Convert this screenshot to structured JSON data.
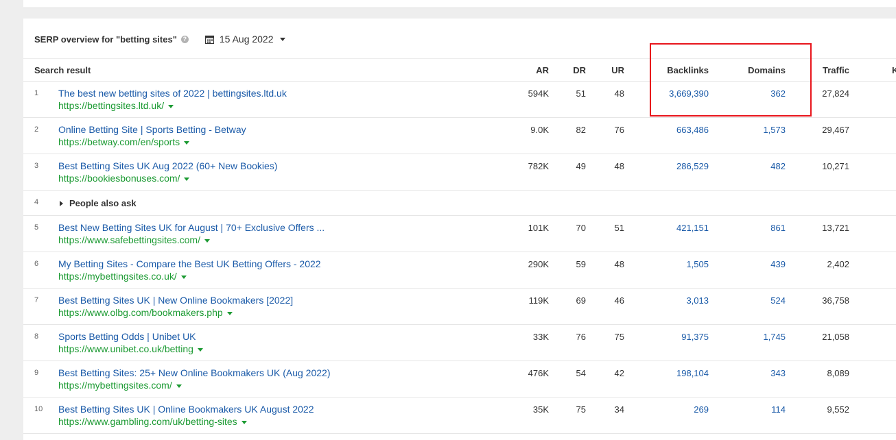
{
  "header": {
    "title": "SERP overview for \"betting sites\"",
    "help_icon": "?",
    "date": "15 Aug 2022"
  },
  "columns": {
    "search_result": "Search result",
    "ar": "AR",
    "dr": "DR",
    "ur": "UR",
    "backlinks": "Backlinks",
    "domains": "Domains",
    "traffic": "Traffic",
    "k": "K"
  },
  "rows": [
    {
      "rank": "1",
      "title": "The best new betting sites of 2022 | bettingsites.ltd.uk",
      "url": "https://bettingsites.ltd.uk/",
      "ar": "594K",
      "dr": "51",
      "ur": "48",
      "backlinks": "3,669,390",
      "domains": "362",
      "traffic": "27,824"
    },
    {
      "rank": "2",
      "title": "Online Betting Site | Sports Betting - Betway",
      "url": "https://betway.com/en/sports",
      "ar": "9.0K",
      "dr": "82",
      "ur": "76",
      "backlinks": "663,486",
      "domains": "1,573",
      "traffic": "29,467"
    },
    {
      "rank": "3",
      "title": "Best Betting Sites UK Aug 2022 (60+ New Bookies)",
      "url": "https://bookiesbonuses.com/",
      "ar": "782K",
      "dr": "49",
      "ur": "48",
      "backlinks": "286,529",
      "domains": "482",
      "traffic": "10,271"
    },
    {
      "rank": "5",
      "title": "Best New Betting Sites UK for August | 70+ Exclusive Offers ...",
      "url": "https://www.safebettingsites.com/",
      "ar": "101K",
      "dr": "70",
      "ur": "51",
      "backlinks": "421,151",
      "domains": "861",
      "traffic": "13,721"
    },
    {
      "rank": "6",
      "title": "My Betting Sites - Compare the Best UK Betting Offers - 2022",
      "url": "https://mybettingsites.co.uk/",
      "ar": "290K",
      "dr": "59",
      "ur": "48",
      "backlinks": "1,505",
      "domains": "439",
      "traffic": "2,402"
    },
    {
      "rank": "7",
      "title": "Best Betting Sites UK | New Online Bookmakers [2022]",
      "url": "https://www.olbg.com/bookmakers.php",
      "ar": "119K",
      "dr": "69",
      "ur": "46",
      "backlinks": "3,013",
      "domains": "524",
      "traffic": "36,758"
    },
    {
      "rank": "8",
      "title": "Sports Betting Odds | Unibet UK",
      "url": "https://www.unibet.co.uk/betting",
      "ar": "33K",
      "dr": "76",
      "ur": "75",
      "backlinks": "91,375",
      "domains": "1,745",
      "traffic": "21,058"
    },
    {
      "rank": "9",
      "title": "Best Betting Sites: 25+ New Online Bookmakers UK (Aug 2022)",
      "url": "https://mybettingsites.com/",
      "ar": "476K",
      "dr": "54",
      "ur": "42",
      "backlinks": "198,104",
      "domains": "343",
      "traffic": "8,089"
    },
    {
      "rank": "10",
      "title": "Best Betting Sites UK | Online Bookmakers UK August 2022",
      "url": "https://www.gambling.com/uk/betting-sites",
      "ar": "35K",
      "dr": "75",
      "ur": "34",
      "backlinks": "269",
      "domains": "114",
      "traffic": "9,552"
    }
  ],
  "people_also_ask": {
    "rank": "4",
    "label": "People also ask"
  },
  "colors": {
    "link_blue": "#1a5aa8",
    "url_green": "#1b9a32",
    "highlight_red": "#e8141b"
  }
}
